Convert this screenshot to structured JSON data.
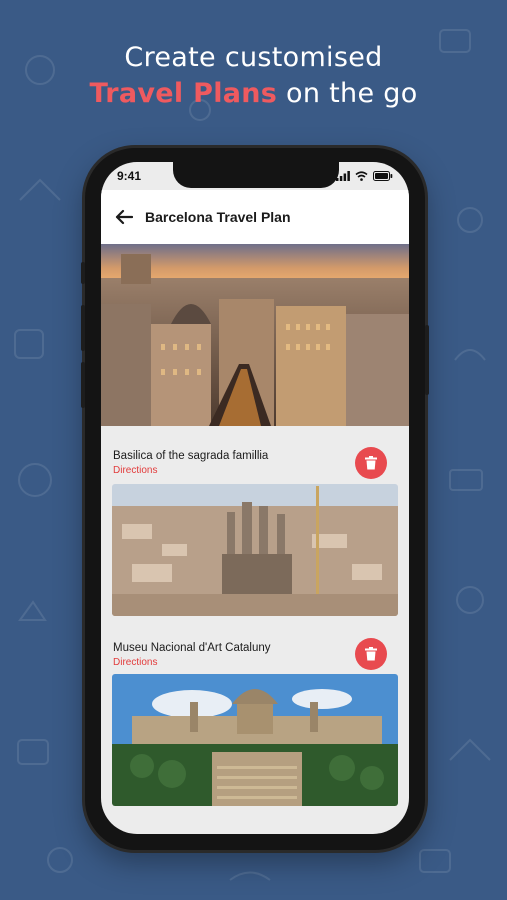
{
  "headline": {
    "line1": "Create customised",
    "accent": "Travel Plans",
    "rest": " on the go"
  },
  "status": {
    "time": "9:41"
  },
  "appbar": {
    "title": "Barcelona Travel Plan"
  },
  "places": [
    {
      "name": "Basilica of the sagrada famillia",
      "link": "Directions"
    },
    {
      "name": "Museu Nacional d'Art Cataluny",
      "link": "Directions"
    }
  ],
  "colors": {
    "background": "#3a5a86",
    "accent": "#ef5a5f",
    "delete": "#e84a4f",
    "link": "#e23b3b"
  },
  "icons": [
    "back-arrow-icon",
    "trash-icon",
    "signal-icon",
    "wifi-icon",
    "battery-icon"
  ]
}
